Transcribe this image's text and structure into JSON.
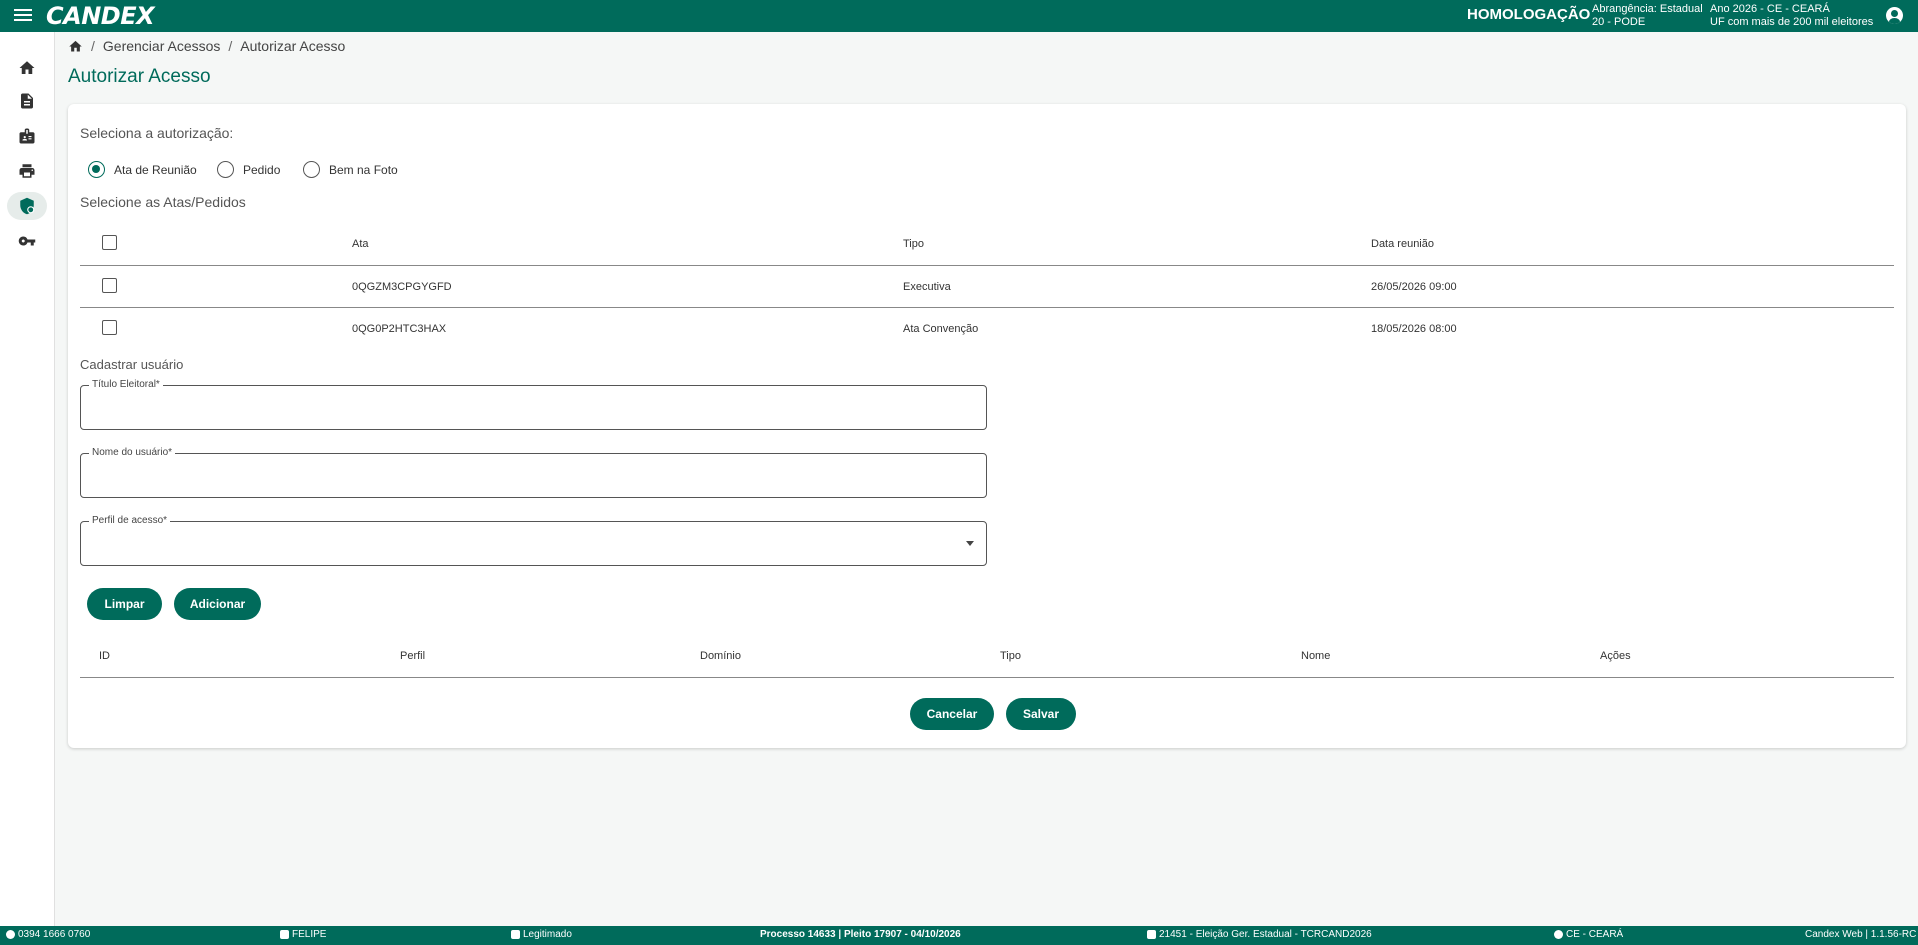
{
  "topbar": {
    "logo": "CANDEX",
    "environment": "HOMOLOGAÇÃO",
    "scope_line1": "Abrangência: Estadual",
    "scope_line2": "20 - PODE",
    "year_line1": "Ano 2026 - CE - CEARÁ",
    "year_line2": "UF com mais de 200 mil eleitores"
  },
  "breadcrumb": {
    "item1": "Gerenciar Acessos",
    "item2": "Autorizar Acesso"
  },
  "page_title": "Autorizar Acesso",
  "authorization": {
    "label": "Seleciona a autorização:",
    "options": [
      "Ata de Reunião",
      "Pedido",
      "Bem na Foto"
    ],
    "selected": "Ata de Reunião"
  },
  "atas": {
    "label": "Selecione as Atas/Pedidos",
    "headers": {
      "ata": "Ata",
      "tipo": "Tipo",
      "data": "Data reunião"
    },
    "rows": [
      {
        "ata": "0QGZM3CPGYGFD",
        "tipo": "Executiva",
        "data": "26/05/2026 09:00"
      },
      {
        "ata": "0QG0P2HTC3HAX",
        "tipo": "Ata Convenção",
        "data": "18/05/2026 08:00"
      }
    ]
  },
  "user_form": {
    "label": "Cadastrar usuário",
    "titulo_label": "Título Eleitoral*",
    "titulo_value": "",
    "nome_label": "Nome do usuário*",
    "nome_value": "",
    "perfil_label": "Perfil de acesso*",
    "perfil_value": ""
  },
  "buttons": {
    "limpar": "Limpar",
    "adicionar": "Adicionar",
    "cancelar": "Cancelar",
    "salvar": "Salvar"
  },
  "users_table": {
    "headers": {
      "id": "ID",
      "perfil": "Perfil",
      "dominio": "Domínio",
      "tipo": "Tipo",
      "nome": "Nome",
      "acoes": "Ações"
    }
  },
  "footer": {
    "phone": "0394 1666 0760",
    "user": "FELIPE",
    "status": "Legitimado",
    "process": "Processo 14633 | Pleito 17907 - 04/10/2026",
    "election": "21451 - Eleição Ger. Estadual - TCRCAND2026",
    "uf": "CE - CEARÁ",
    "version": "Candex Web | 1.1.56-RC"
  },
  "colors": {
    "primary": "#006b5b",
    "background": "#f5f7f6"
  },
  "icons": {
    "nav": [
      "home-icon",
      "document-icon",
      "badge-icon",
      "print-icon",
      "shield-icon",
      "key-icon"
    ]
  }
}
